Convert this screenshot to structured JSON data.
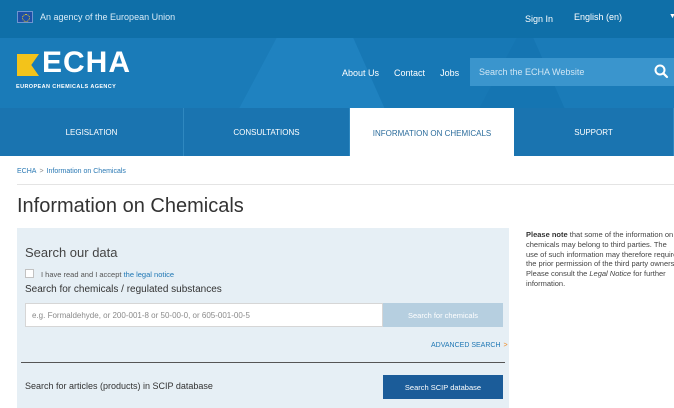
{
  "topbar": {
    "agency": "An agency of the European Union",
    "signin": "Sign In",
    "language": "English (en)"
  },
  "header": {
    "logo_text": "ECHA",
    "logo_sub": "EUROPEAN CHEMICALS AGENCY",
    "nav": [
      "About Us",
      "Contact",
      "Jobs"
    ],
    "search_placeholder": "Search the ECHA Website"
  },
  "tabs": [
    {
      "label": "LEGISLATION"
    },
    {
      "label": "CONSULTATIONS"
    },
    {
      "label": "INFORMATION ON CHEMICALS",
      "active": true
    },
    {
      "label": "SUPPORT"
    }
  ],
  "breadcrumb": [
    "ECHA",
    "Information on Chemicals"
  ],
  "breadcrumb_sep": ">",
  "page_title": "Information on Chemicals",
  "search_panel": {
    "title": "Search our data",
    "accept_text": "I have read and I accept",
    "accept_link": "the legal notice",
    "chem_label": "Search for chemicals / regulated substances",
    "chem_placeholder": "e.g. Formaldehyde, or 200-001-8 or 50-00-0, or 605-001-00-5",
    "chem_button": "Search for chemicals",
    "advanced": "ADVANCED SEARCH",
    "advanced_chevron": ">",
    "scip_label": "Search for articles (products) in SCIP database",
    "scip_button": "Search SCIP database"
  },
  "note": {
    "bold": "Please note",
    "text1": " that some of the information on chemicals may belong to third parties. The use of such information may therefore require the prior permission of the third party owners. Please consult the ",
    "link": "Legal Notice",
    "text2": " for further information."
  },
  "colors": {
    "topbar": "#0f6fa8",
    "header": "#1a7bb8",
    "accent": "#1b5c99",
    "panel": "#e6eff5"
  }
}
